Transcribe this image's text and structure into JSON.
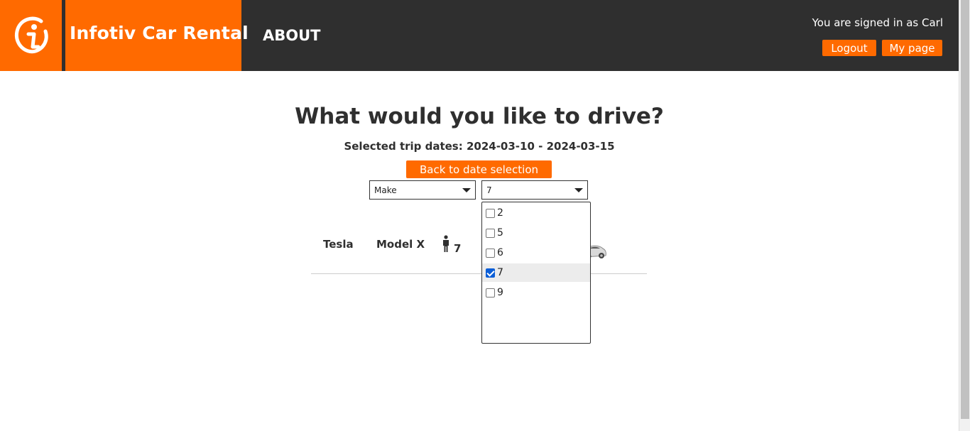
{
  "header": {
    "brand": "Infotiv Car Rental",
    "nav_about": "ABOUT",
    "signed_in_text": "You are signed in as Carl",
    "logout_label": "Logout",
    "mypage_label": "My page",
    "brand_color": "#ff6a00",
    "bar_color": "#2f2f2f"
  },
  "main": {
    "title": "What would you like to drive?",
    "dates_text": "Selected trip dates: 2024-03-10 - 2024-03-15",
    "back_label": "Back to date selection"
  },
  "filters": {
    "make_value": "Make",
    "seats_value": "7",
    "seats_options": [
      {
        "label": "2",
        "checked": false
      },
      {
        "label": "5",
        "checked": false
      },
      {
        "label": "6",
        "checked": false
      },
      {
        "label": "7",
        "checked": true
      },
      {
        "label": "9",
        "checked": false
      }
    ]
  },
  "cars": [
    {
      "make": "Tesla",
      "model": "Model X",
      "seats": "7"
    }
  ]
}
